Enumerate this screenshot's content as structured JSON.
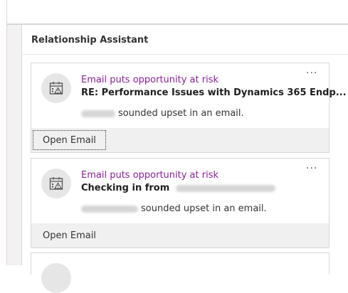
{
  "panel": {
    "title": "Relationship Assistant"
  },
  "cards": [
    {
      "type_label": "Email puts opportunity at risk",
      "title": "RE: Performance Issues with Dynamics 365 Endp...",
      "title_prefix": "",
      "blurred_title_suffix": "",
      "detail_suffix": "sounded upset in an email.",
      "more": "···",
      "action_label": "Open Email",
      "icon": "calendar-alert-icon"
    },
    {
      "type_label": "Email puts opportunity at risk",
      "title": "Checking in from",
      "title_prefix": "Checking in from",
      "detail_suffix": "sounded upset in an email.",
      "more": "···",
      "action_label": "Open Email",
      "icon": "calendar-alert-icon"
    }
  ],
  "colors": {
    "accent_purple": "#8a1f9a",
    "footer_bg": "#f0f0f0",
    "card_border": "#d8d8d8"
  }
}
